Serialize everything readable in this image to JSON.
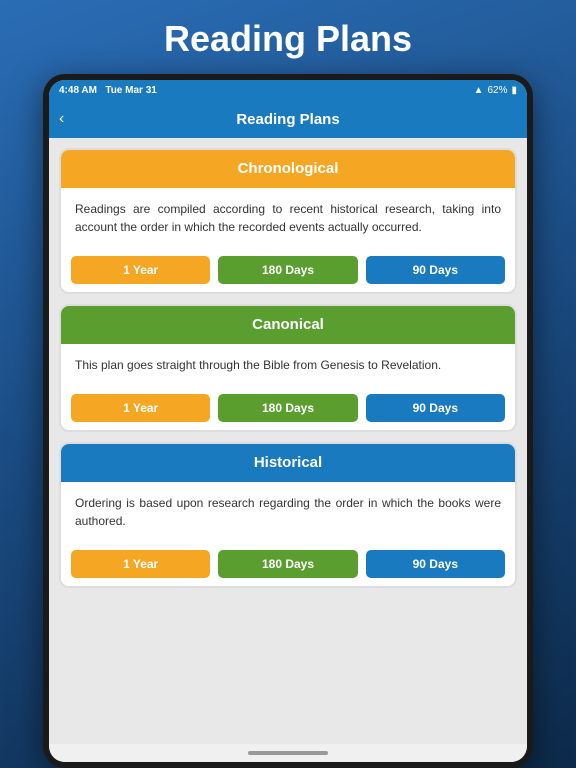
{
  "page": {
    "title": "Reading Plans"
  },
  "status_bar": {
    "time": "4:48 AM",
    "date": "Tue Mar 31",
    "battery": "62%",
    "wifi": "▲"
  },
  "nav": {
    "title": "Reading Plans",
    "back_label": "‹"
  },
  "plans": [
    {
      "id": "chronological",
      "title": "Chronological",
      "header_color": "orange",
      "description": "Readings are compiled according to recent historical research, taking into account the order in which the recorded events actually occurred.",
      "buttons": [
        {
          "label": "1 Year",
          "color": "orange"
        },
        {
          "label": "180 Days",
          "color": "green"
        },
        {
          "label": "90 Days",
          "color": "blue"
        }
      ]
    },
    {
      "id": "canonical",
      "title": "Canonical",
      "header_color": "green",
      "description": "This plan goes straight through the Bible from Genesis to Revelation.",
      "buttons": [
        {
          "label": "1 Year",
          "color": "orange"
        },
        {
          "label": "180 Days",
          "color": "green"
        },
        {
          "label": "90 Days",
          "color": "blue"
        }
      ]
    },
    {
      "id": "historical",
      "title": "Historical",
      "header_color": "blue",
      "description": "Ordering is based upon research regarding the order in which the books were authored.",
      "buttons": [
        {
          "label": "1 Year",
          "color": "orange"
        },
        {
          "label": "180 Days",
          "color": "green"
        },
        {
          "label": "90 Days",
          "color": "blue"
        }
      ]
    }
  ]
}
